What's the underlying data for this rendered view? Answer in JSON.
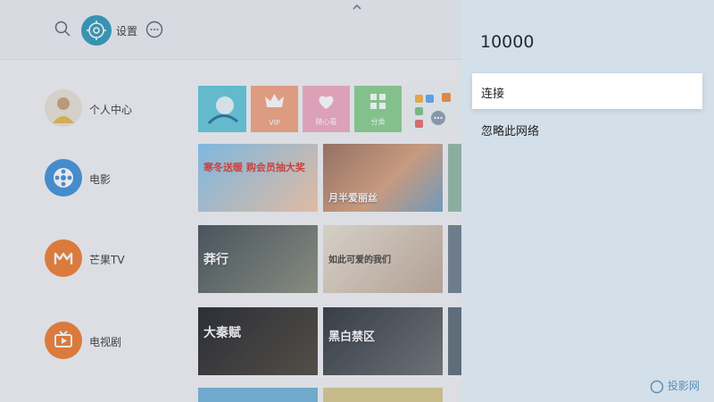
{
  "topbar": {
    "settings_label": "设置"
  },
  "sidebar": {
    "items": [
      {
        "label": "个人中心",
        "icon": "avatar-icon"
      },
      {
        "label": "电影",
        "icon": "film-reel-icon",
        "color": "#3a8fd6"
      },
      {
        "label": "芒果TV",
        "icon": "mango-tv-icon",
        "color": "#f07a2a"
      },
      {
        "label": "电视剧",
        "icon": "tv-icon",
        "color": "#f07a2a"
      }
    ]
  },
  "tiles": {
    "vip": "VIP",
    "favorites": "随心看",
    "apps": "分类",
    "posters": [
      {
        "title": "寒冬送暖 购会员抽大奖"
      },
      {
        "title": "月半爱丽丝"
      },
      {
        "title": "莽行"
      },
      {
        "title": "如此可爱的我们"
      },
      {
        "title": "大秦赋"
      },
      {
        "title": "黑白禁区"
      }
    ]
  },
  "panel": {
    "network_name": "10000",
    "options": [
      {
        "label": "连接",
        "focused": true
      },
      {
        "label": "忽略此网络",
        "focused": false
      }
    ]
  },
  "watermark": {
    "text": "投影网"
  },
  "colors": {
    "accent": "#2a96b8",
    "panel_bg": "#d3e0ea"
  }
}
